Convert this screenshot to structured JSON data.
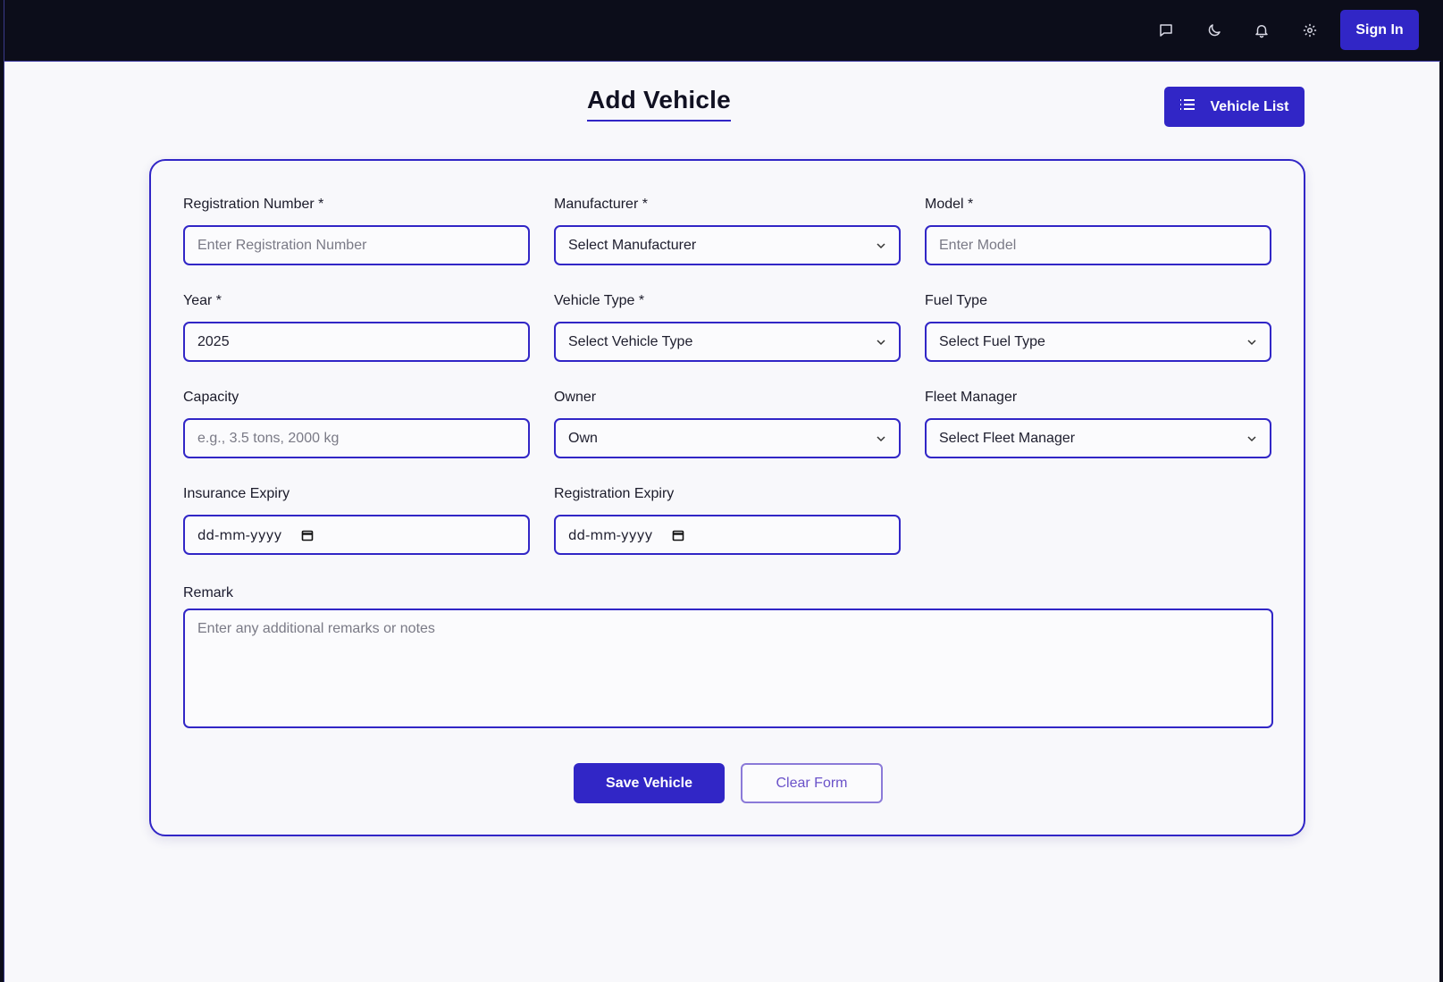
{
  "colors": {
    "primary": "#3126c6",
    "topbar": "#0c0d1a",
    "background": "#f8f8fb"
  },
  "header": {
    "icons": [
      "chat-icon",
      "moon-icon",
      "bell-icon",
      "gear-icon"
    ],
    "sign_in_label": "Sign In"
  },
  "page": {
    "title": "Add Vehicle",
    "vehicle_list_label": "Vehicle List"
  },
  "form": {
    "registration_number": {
      "label": "Registration Number *",
      "placeholder": "Enter Registration Number"
    },
    "manufacturer": {
      "label": "Manufacturer *",
      "value": "Select Manufacturer"
    },
    "model": {
      "label": "Model *",
      "placeholder": "Enter Model"
    },
    "year": {
      "label": "Year *",
      "value": "2025"
    },
    "vehicle_type": {
      "label": "Vehicle Type *",
      "value": "Select Vehicle Type"
    },
    "fuel_type": {
      "label": "Fuel Type",
      "value": "Select Fuel Type"
    },
    "capacity": {
      "label": "Capacity",
      "placeholder": "e.g., 3.5 tons, 2000 kg"
    },
    "owner": {
      "label": "Owner",
      "value": "Own"
    },
    "fleet_manager": {
      "label": "Fleet Manager",
      "value": "Select Fleet Manager"
    },
    "insurance_expiry": {
      "label": "Insurance Expiry",
      "value": "dd-mm-yyyy"
    },
    "registration_expiry": {
      "label": "Registration Expiry",
      "value": "dd-mm-yyyy"
    },
    "remark": {
      "label": "Remark",
      "placeholder": "Enter any additional remarks or notes"
    },
    "save_label": "Save Vehicle",
    "clear_label": "Clear Form"
  }
}
